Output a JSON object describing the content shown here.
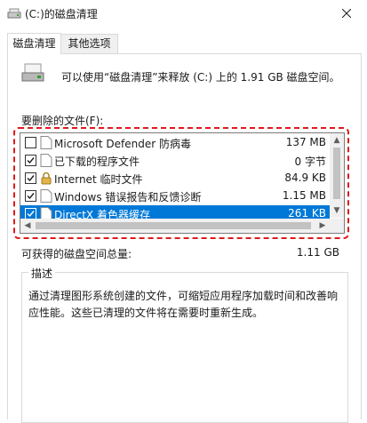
{
  "window": {
    "title": "(C:)的磁盘清理",
    "close_icon": "close-icon"
  },
  "tabs": [
    {
      "label": "磁盘清理",
      "active": true
    },
    {
      "label": "其他选项",
      "active": false
    }
  ],
  "header": {
    "text": "可以使用“磁盘清理”来释放 (C:) 上的 1.91 GB 磁盘空间。",
    "icon": "drive-icon"
  },
  "files_label": "要删除的文件(F):",
  "files": [
    {
      "name": "Microsoft Defender 防病毒",
      "size": "137 MB",
      "checked": false,
      "icon": "file-icon",
      "selected": false
    },
    {
      "name": "已下载的程序文件",
      "size": "0 字节",
      "checked": true,
      "icon": "folder-icon",
      "selected": false
    },
    {
      "name": "Internet 临时文件",
      "size": "84.9 KB",
      "checked": true,
      "icon": "lock-icon",
      "selected": false
    },
    {
      "name": "Windows 错误报告和反馈诊断",
      "size": "1.15 MB",
      "checked": true,
      "icon": "file-icon",
      "selected": false
    },
    {
      "name": "DirectX 着色器缓存",
      "size": "261 KB",
      "checked": true,
      "icon": "file-icon",
      "selected": true
    }
  ],
  "total": {
    "label": "可获得的磁盘空间总量:",
    "value": "1.11 GB"
  },
  "description": {
    "label": "描述",
    "text": "通过清理图形系统创建的文件，可缩短应用程序加载时间和改善响应性能。这些已清理的文件将在需要时重新生成。"
  },
  "colors": {
    "selection": "#0078d7",
    "highlight": "#e0191b"
  }
}
